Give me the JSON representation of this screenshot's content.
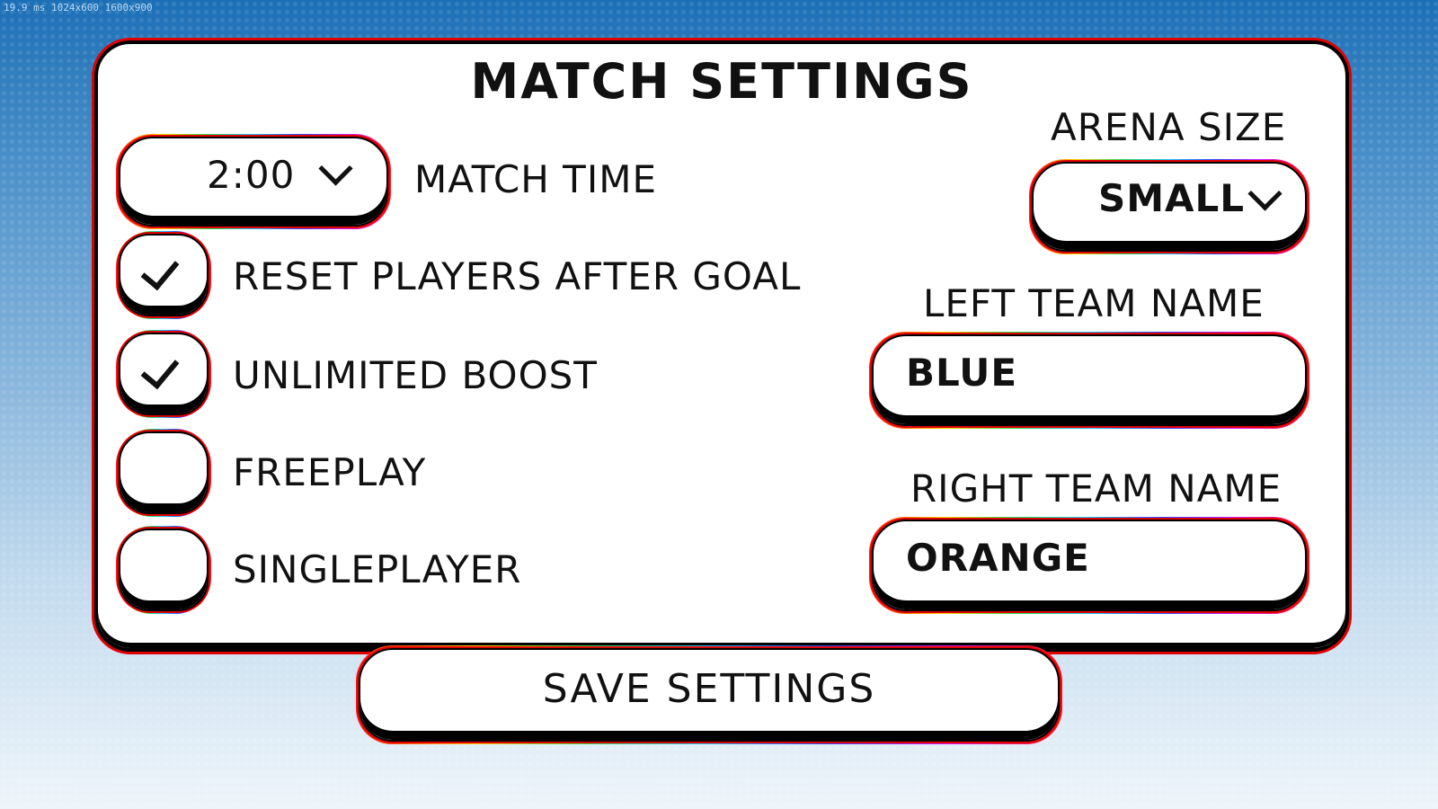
{
  "debug_text": "19.9 ms  1024x600  1600x900",
  "title": "MATCH SETTINGS",
  "match_time": {
    "value": "2:00",
    "label": "MATCH TIME"
  },
  "checkboxes": [
    {
      "label": "RESET PLAYERS AFTER GOAL",
      "checked": true
    },
    {
      "label": "UNLIMITED BOOST",
      "checked": true
    },
    {
      "label": "FREEPLAY",
      "checked": false
    },
    {
      "label": "SINGLEPLAYER",
      "checked": false
    }
  ],
  "arena_size": {
    "label": "ARENA SIZE",
    "value": "SMALL"
  },
  "left_team": {
    "label": "LEFT TEAM NAME",
    "value": "BLUE"
  },
  "right_team": {
    "label": "RIGHT TEAM NAME",
    "value": "ORANGE"
  },
  "save_button": "SAVE SETTINGS",
  "icons": {
    "dropdown": "chevron-down-icon",
    "check": "checkmark-icon"
  },
  "colors": {
    "outline_red": "#e00000",
    "panel": "#ffffff",
    "text": "#111111"
  }
}
